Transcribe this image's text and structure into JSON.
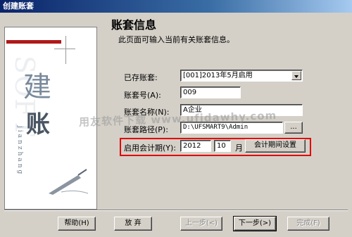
{
  "window": {
    "title": "创建账套"
  },
  "side_panel": {
    "char_top": "建",
    "char_bottom": "账",
    "pinyin": "jianzhang",
    "ghost_text": "SOFT"
  },
  "header": {
    "title": "账套信息",
    "description": "此页面可输入当前有关账套信息。"
  },
  "form": {
    "existing": {
      "label": "已存账套:",
      "value": "[001]2013年5月启用"
    },
    "number": {
      "label": "账套号(A):",
      "value": "009"
    },
    "name": {
      "label": "账套名称(N):",
      "value": "A企业"
    },
    "path": {
      "label": "账套路径(P):",
      "value": "D:\\UFSMART9\\Admin",
      "browse_label": "..."
    },
    "period": {
      "label": "启用会计期(Y):",
      "year": "2012",
      "month": "10",
      "month_unit": "月",
      "settings_label": "会计期间设置"
    }
  },
  "watermark": "用友软件下载  www.ufidawhy.com",
  "footer": {
    "help": "帮助(H)",
    "abandon": "放 弃",
    "prev": "上一步(<)",
    "next": "下一步(>)",
    "finish": "完成(F)"
  },
  "colors": {
    "highlight": "#e00000",
    "accent": "#b01818",
    "titlebar": "#0a246a"
  }
}
